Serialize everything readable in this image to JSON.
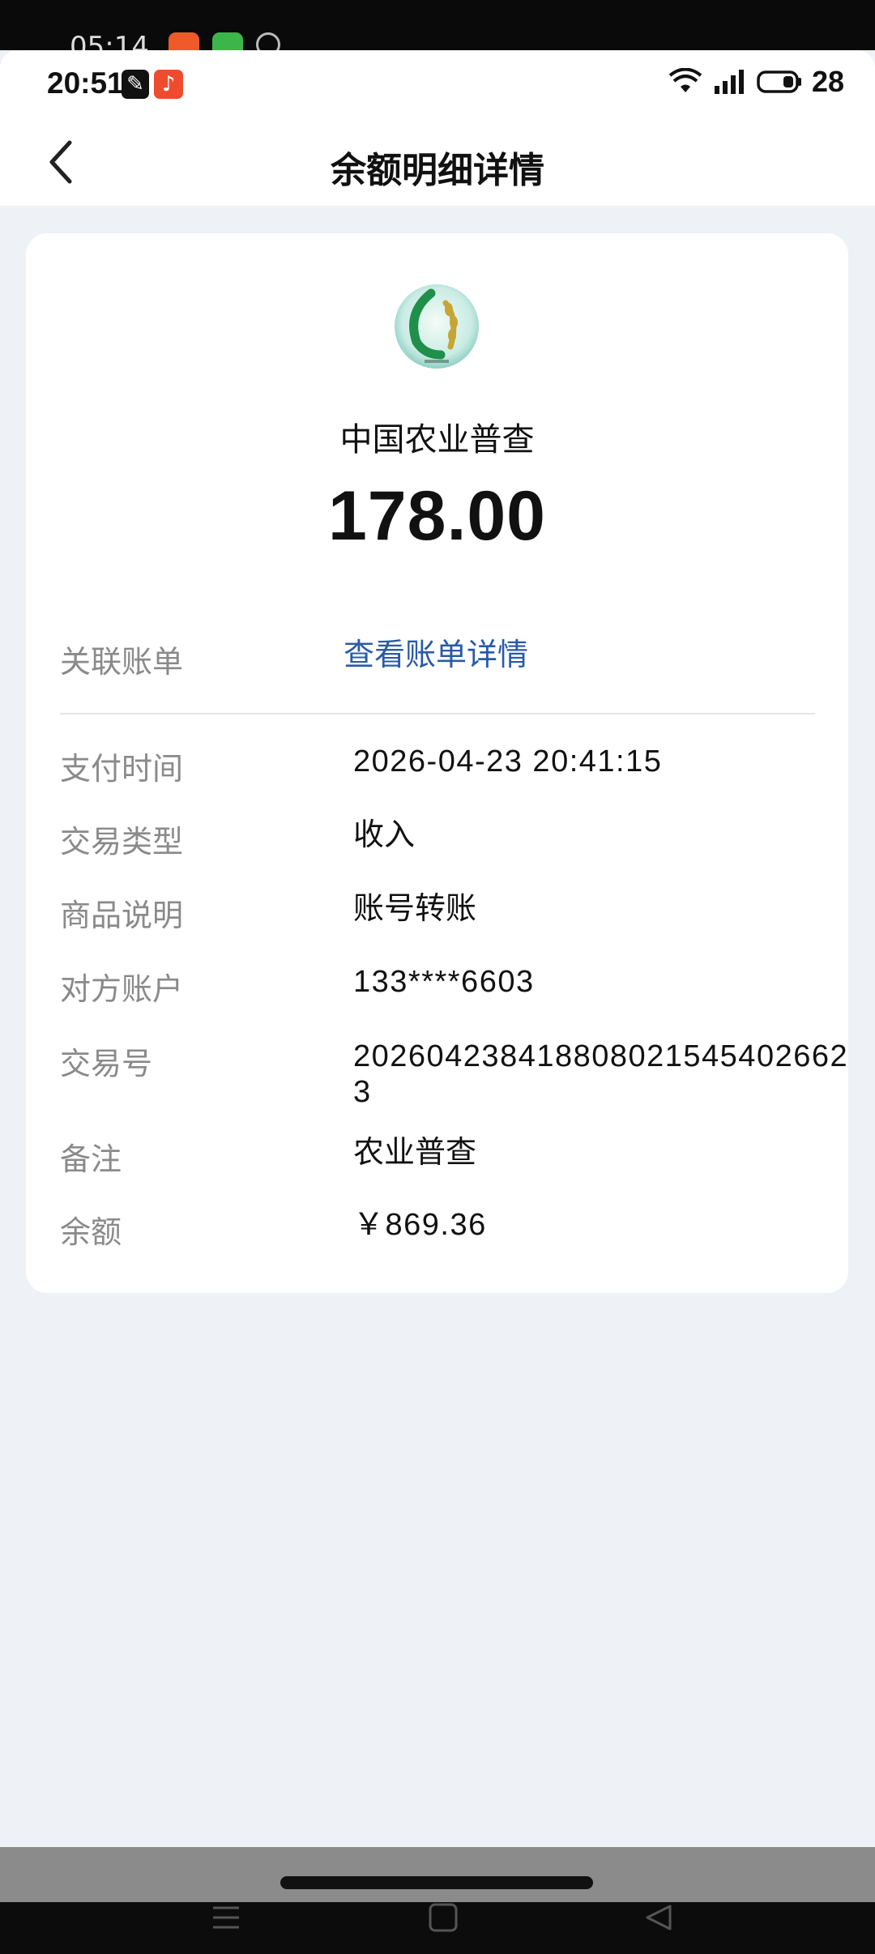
{
  "ghost_status": {
    "time": "05:14"
  },
  "status_bar": {
    "time": "20:51",
    "battery": "28"
  },
  "header": {
    "title": "余额明细详情"
  },
  "summary": {
    "merchant": "中国农业普查",
    "amount": "178.00"
  },
  "details": {
    "related_bill": {
      "label": "关联账单",
      "value": "查看账单详情"
    },
    "pay_time": {
      "label": "支付时间",
      "value": "2026-04-23 20:41:15"
    },
    "trade_type": {
      "label": "交易类型",
      "value": "收入"
    },
    "goods_desc": {
      "label": "商品说明",
      "value": "账号转账"
    },
    "counterparty": {
      "label": "对方账户",
      "value": "133****6603"
    },
    "trade_no": {
      "label": "交易号",
      "value": "2026042384188080215454026623"
    },
    "remark": {
      "label": "备注",
      "value": "农业普查"
    },
    "balance": {
      "label": "余额",
      "value": "￥869.36"
    }
  },
  "colors": {
    "link": "#2a5aa8",
    "label": "#8a8a8a",
    "page_bg": "#eef1f6"
  }
}
